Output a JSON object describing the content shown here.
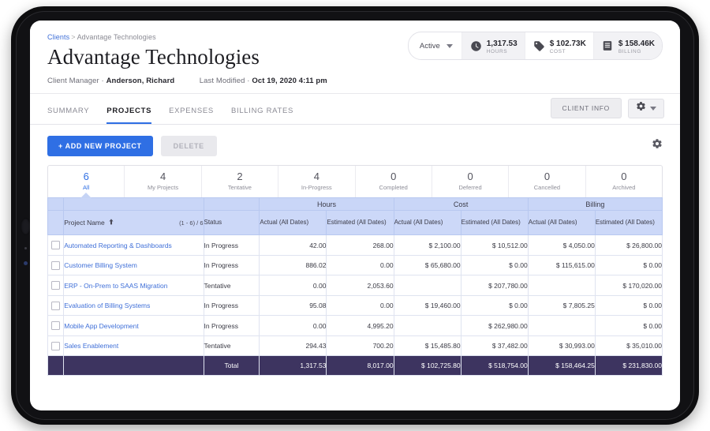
{
  "breadcrumb": {
    "root": "Clients",
    "separator": ">",
    "current": "Advantage Technologies"
  },
  "header": {
    "title": "Advantage Technologies",
    "client_manager_label": "Client Manager ·",
    "client_manager_value": "Anderson, Richard",
    "last_modified_label": "Last Modified ·",
    "last_modified_value": "Oct 19, 2020 4:11 pm"
  },
  "stats": {
    "filter_label": "Active",
    "items": [
      {
        "icon": "clock-icon",
        "value": "1,317.53",
        "label": "HOURS"
      },
      {
        "icon": "tag-icon",
        "value": "$ 102.73K",
        "label": "COST"
      },
      {
        "icon": "invoice-icon",
        "value": "$ 158.46K",
        "label": "BILLING"
      }
    ]
  },
  "tabs": [
    {
      "label": "SUMMARY",
      "active": false
    },
    {
      "label": "PROJECTS",
      "active": true
    },
    {
      "label": "EXPENSES",
      "active": false
    },
    {
      "label": "BILLING RATES",
      "active": false
    }
  ],
  "header_actions": {
    "client_info": "CLIENT INFO"
  },
  "toolbar": {
    "add_label": "+ ADD NEW PROJECT",
    "delete_label": "DELETE"
  },
  "filters": [
    {
      "count": "6",
      "label": "All",
      "active": true
    },
    {
      "count": "4",
      "label": "My Projects",
      "active": false
    },
    {
      "count": "2",
      "label": "Tentative",
      "active": false
    },
    {
      "count": "4",
      "label": "In-Progress",
      "active": false
    },
    {
      "count": "0",
      "label": "Completed",
      "active": false
    },
    {
      "count": "0",
      "label": "Deferred",
      "active": false
    },
    {
      "count": "0",
      "label": "Cancelled",
      "active": false
    },
    {
      "count": "0",
      "label": "Archived",
      "active": false
    }
  ],
  "table": {
    "group_headers": [
      {
        "label": "Hours",
        "span": 2
      },
      {
        "label": "Cost",
        "span": 2
      },
      {
        "label": "Billing",
        "span": 2
      }
    ],
    "col_project_name": "Project Name",
    "sort_icon": "sort-ascending-icon",
    "pagination": "(1 - 6) / 6",
    "col_status": "Status",
    "sub_headers": [
      "Actual (All Dates)",
      "Estimated (All Dates)",
      "Actual (All Dates)",
      "Estimated (All Dates)",
      "Actual (All Dates)",
      "Estimated (All Dates)"
    ],
    "rows": [
      {
        "name": "Automated Reporting & Dashboards",
        "status": "In Progress",
        "hours_actual": "42.00",
        "hours_estimated": "268.00",
        "cost_actual": "$ 2,100.00",
        "cost_estimated": "$ 10,512.00",
        "billing_actual": "$ 4,050.00",
        "billing_estimated": "$ 26,800.00"
      },
      {
        "name": "Customer Billing System",
        "status": "In Progress",
        "hours_actual": "886.02",
        "hours_estimated": "0.00",
        "cost_actual": "$ 65,680.00",
        "cost_estimated": "$ 0.00",
        "billing_actual": "$ 115,615.00",
        "billing_estimated": "$ 0.00"
      },
      {
        "name": "ERP - On-Prem to SAAS Migration",
        "status": "Tentative",
        "hours_actual": "0.00",
        "hours_estimated": "2,053.60",
        "cost_actual": "",
        "cost_estimated": "$ 207,780.00",
        "billing_actual": "",
        "billing_estimated": "$ 170,020.00"
      },
      {
        "name": "Evaluation of Billing Systems",
        "status": "In Progress",
        "hours_actual": "95.08",
        "hours_estimated": "0.00",
        "cost_actual": "$ 19,460.00",
        "cost_estimated": "$ 0.00",
        "billing_actual": "$ 7,805.25",
        "billing_estimated": "$ 0.00"
      },
      {
        "name": "Mobile App Development",
        "status": "In Progress",
        "hours_actual": "0.00",
        "hours_estimated": "4,995.20",
        "cost_actual": "",
        "cost_estimated": "$ 262,980.00",
        "billing_actual": "",
        "billing_estimated": "$ 0.00"
      },
      {
        "name": "Sales Enablement",
        "status": "Tentative",
        "hours_actual": "294.43",
        "hours_estimated": "700.20",
        "cost_actual": "$ 15,485.80",
        "cost_estimated": "$ 37,482.00",
        "billing_actual": "$ 30,993.00",
        "billing_estimated": "$ 35,010.00"
      }
    ],
    "total": {
      "label": "Total",
      "hours_actual": "1,317.53",
      "hours_estimated": "8,017.00",
      "cost_actual": "$ 102,725.80",
      "cost_estimated": "$ 518,754.00",
      "billing_actual": "$ 158,464.25",
      "billing_estimated": "$ 231,830.00"
    }
  },
  "colors": {
    "accent": "#2f6fe4",
    "link": "#3f6fd8",
    "header_band": "#c9d6f7",
    "total_band": "#3d3460"
  }
}
